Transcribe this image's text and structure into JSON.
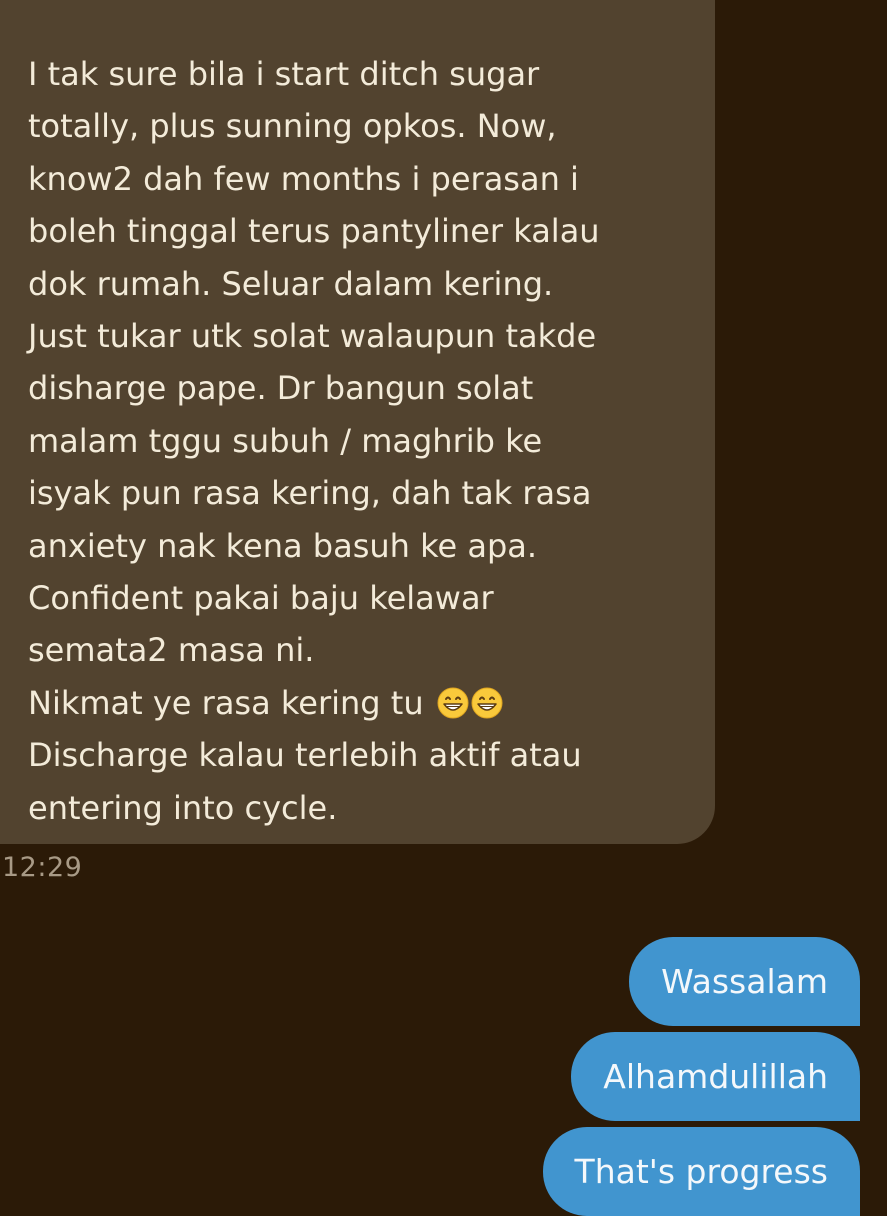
{
  "incoming_message": {
    "text": "I tak sure bila i start ditch sugar\ntotally, plus sunning opkos. Now,\nknow2 dah few months i perasan i\nboleh tinggal terus pantyliner kalau\ndok rumah. Seluar dalam kering.\nJust tukar utk solat walaupun takde\ndisharge pape. Dr bangun solat\nmalam tggu subuh / maghrib ke\nisyak pun rasa kering, dah tak rasa\nanxiety nak kena basuh ke apa.\nConfident pakai baju kelawar\nsemata2 masa ni.\nNikmat ye rasa kering tu",
    "emoji": [
      "grinning-face-with-smiling-eyes",
      "grinning-face-with-smiling-eyes"
    ],
    "text_after_emoji": "\nDischarge kalau terlebih aktif atau\nentering into cycle.",
    "time": "12:29"
  },
  "outgoing_messages": [
    {
      "text": "Wassalam"
    },
    {
      "text": "Alhamdulillah"
    },
    {
      "text": "That's progress"
    }
  ],
  "colors": {
    "background": "#2b1a07",
    "incoming_bubble": "#52432f",
    "outgoing_bubble": "#4195cf",
    "incoming_text": "#f3ebd9",
    "timestamp": "#a89a86"
  }
}
